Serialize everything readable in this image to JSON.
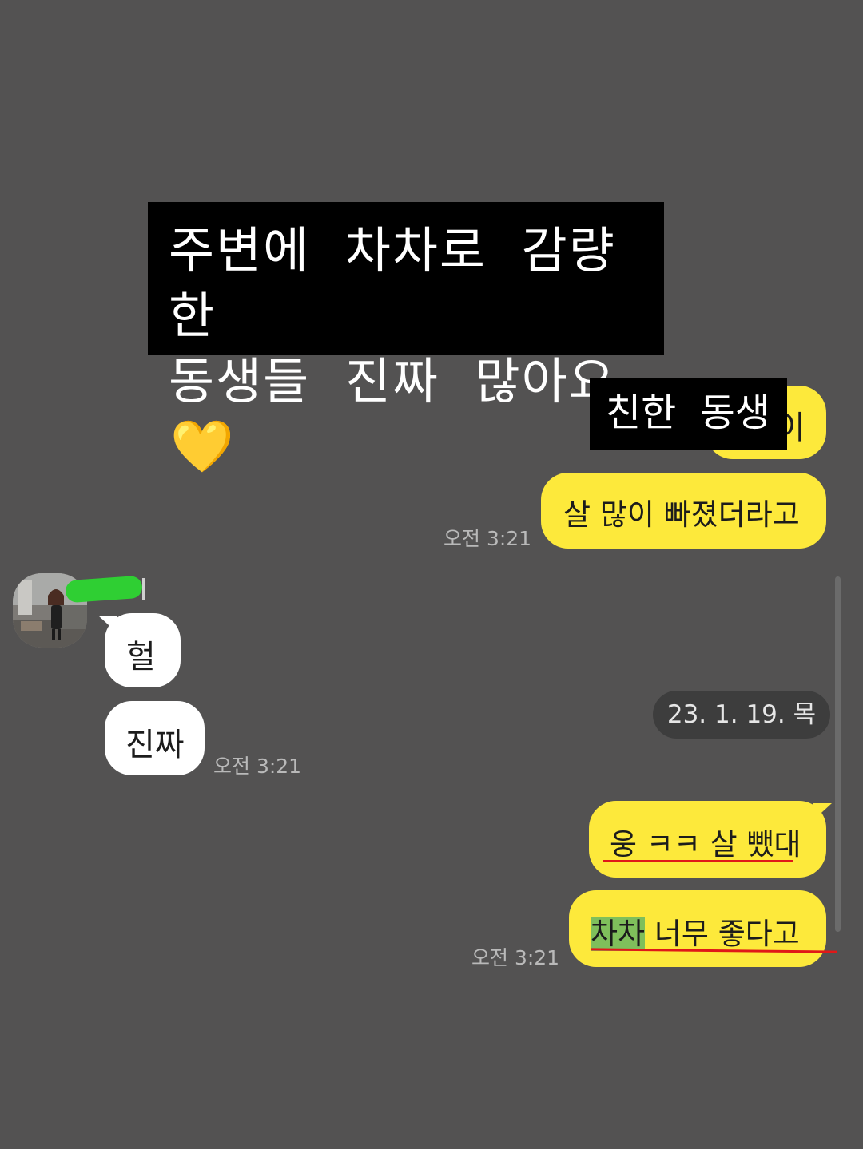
{
  "captions": {
    "main_line1": "주변에 차차로 감량한",
    "main_line2": "동생들 진짜 많아요",
    "main_emoji": "💛",
    "friend_label": "친한 동생"
  },
  "date_divider": "23. 1. 19. 목",
  "messages": {
    "out_partial_tail": "이",
    "out_1": "살 많이 빠졌더라고",
    "out_1_time": "오전 3:21",
    "in_1": "헐",
    "in_2": "진짜",
    "in_time": "오전 3:21",
    "out_2": "웅 ㅋㅋ 살 뺐대",
    "out_3_highlight": "차차",
    "out_3_rest": " 너무 좋다고",
    "out_3_time": "오전 3:21"
  },
  "colors": {
    "background": "#535252",
    "outgoing_bubble": "#fde93b",
    "incoming_bubble": "#ffffff",
    "highlight": "#7fbf5b",
    "underline": "#e01818",
    "name_mask": "#2fcf33"
  }
}
